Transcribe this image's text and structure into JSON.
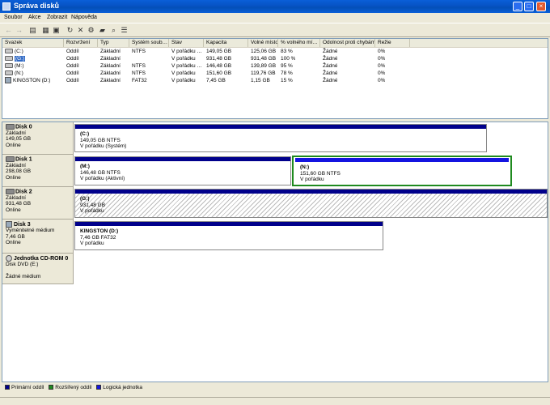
{
  "window": {
    "title": "Správa disků"
  },
  "menu": [
    "Soubor",
    "Akce",
    "Zobrazit",
    "Nápověda"
  ],
  "toolbar_icons": [
    "back-icon",
    "forward-icon",
    "console-tree-icon",
    "properties-icon",
    "help-icon",
    "refresh-icon",
    "delete-icon",
    "settings-icon",
    "open-icon",
    "search-icon",
    "list-icon"
  ],
  "columns": [
    "Svazek",
    "Rozvržení",
    "Typ",
    "Systém soub…",
    "Stav",
    "Kapacita",
    "Volné místo",
    "% volného mí…",
    "Odolnost proti chybám",
    "Režie"
  ],
  "volumes": [
    {
      "name": "(C:)",
      "layout": "Oddíl",
      "type": "Základní",
      "fs": "NTFS",
      "status": "V pořádku …",
      "capacity": "149,05 GB",
      "free": "125,06 GB",
      "pct": "83 %",
      "fault": "Žádné",
      "overhead": "0%"
    },
    {
      "name": "(G:)",
      "layout": "Oddíl",
      "type": "Základní",
      "fs": "",
      "status": "V pořádku",
      "capacity": "931,48 GB",
      "free": "931,48 GB",
      "pct": "100 %",
      "fault": "Žádné",
      "overhead": "0%"
    },
    {
      "name": "(M:)",
      "layout": "Oddíl",
      "type": "Základní",
      "fs": "NTFS",
      "status": "V pořádku …",
      "capacity": "146,48 GB",
      "free": "139,89 GB",
      "pct": "95 %",
      "fault": "Žádné",
      "overhead": "0%"
    },
    {
      "name": "(N:)",
      "layout": "Oddíl",
      "type": "Základní",
      "fs": "NTFS",
      "status": "V pořádku",
      "capacity": "151,60 GB",
      "free": "119,76 GB",
      "pct": "78 %",
      "fault": "Žádné",
      "overhead": "0%"
    },
    {
      "name": "KINGSTON (D:)",
      "layout": "Oddíl",
      "type": "Základní",
      "fs": "FAT32",
      "status": "V pořádku",
      "capacity": "7,45 GB",
      "free": "1,15 GB",
      "pct": "15 %",
      "fault": "Žádné",
      "overhead": "0%"
    }
  ],
  "disks": [
    {
      "name": "Disk 0",
      "type": "Základní",
      "size": "149,05 GB",
      "state": "Online"
    },
    {
      "name": "Disk 1",
      "type": "Základní",
      "size": "298,08 GB",
      "state": "Online"
    },
    {
      "name": "Disk 2",
      "type": "Základní",
      "size": "931,48 GB",
      "state": "Online"
    },
    {
      "name": "Disk 3",
      "type": "Vyměnitelné médium",
      "size": "7,46 GB",
      "state": "Online"
    },
    {
      "name": "Jednotka CD-ROM 0",
      "type": "Disk DVD (E:)",
      "size": "",
      "state": "Žádné médium"
    }
  ],
  "partitions": {
    "c": {
      "name": "(C:)",
      "size": "149,05 GB NTFS",
      "status": "V pořádku (Systém)"
    },
    "m": {
      "name": "(M:)",
      "size": "146,48 GB NTFS",
      "status": "V pořádku (Aktivní)"
    },
    "n": {
      "name": "(N:)",
      "size": "151,60 GB NTFS",
      "status": "V pořádku"
    },
    "g": {
      "name": "(G:)",
      "size": "931,48 GB",
      "status": "V pořádku"
    },
    "d": {
      "name": "KINGSTON  (D:)",
      "size": "7,46 GB FAT32",
      "status": "V pořádku"
    }
  },
  "legend": [
    {
      "label": "Primární oddíl",
      "color": "#00008b"
    },
    {
      "label": "Rozšířený oddíl",
      "color": "#1f8a1f"
    },
    {
      "label": "Logická jednotka",
      "color": "#1414e0"
    }
  ]
}
